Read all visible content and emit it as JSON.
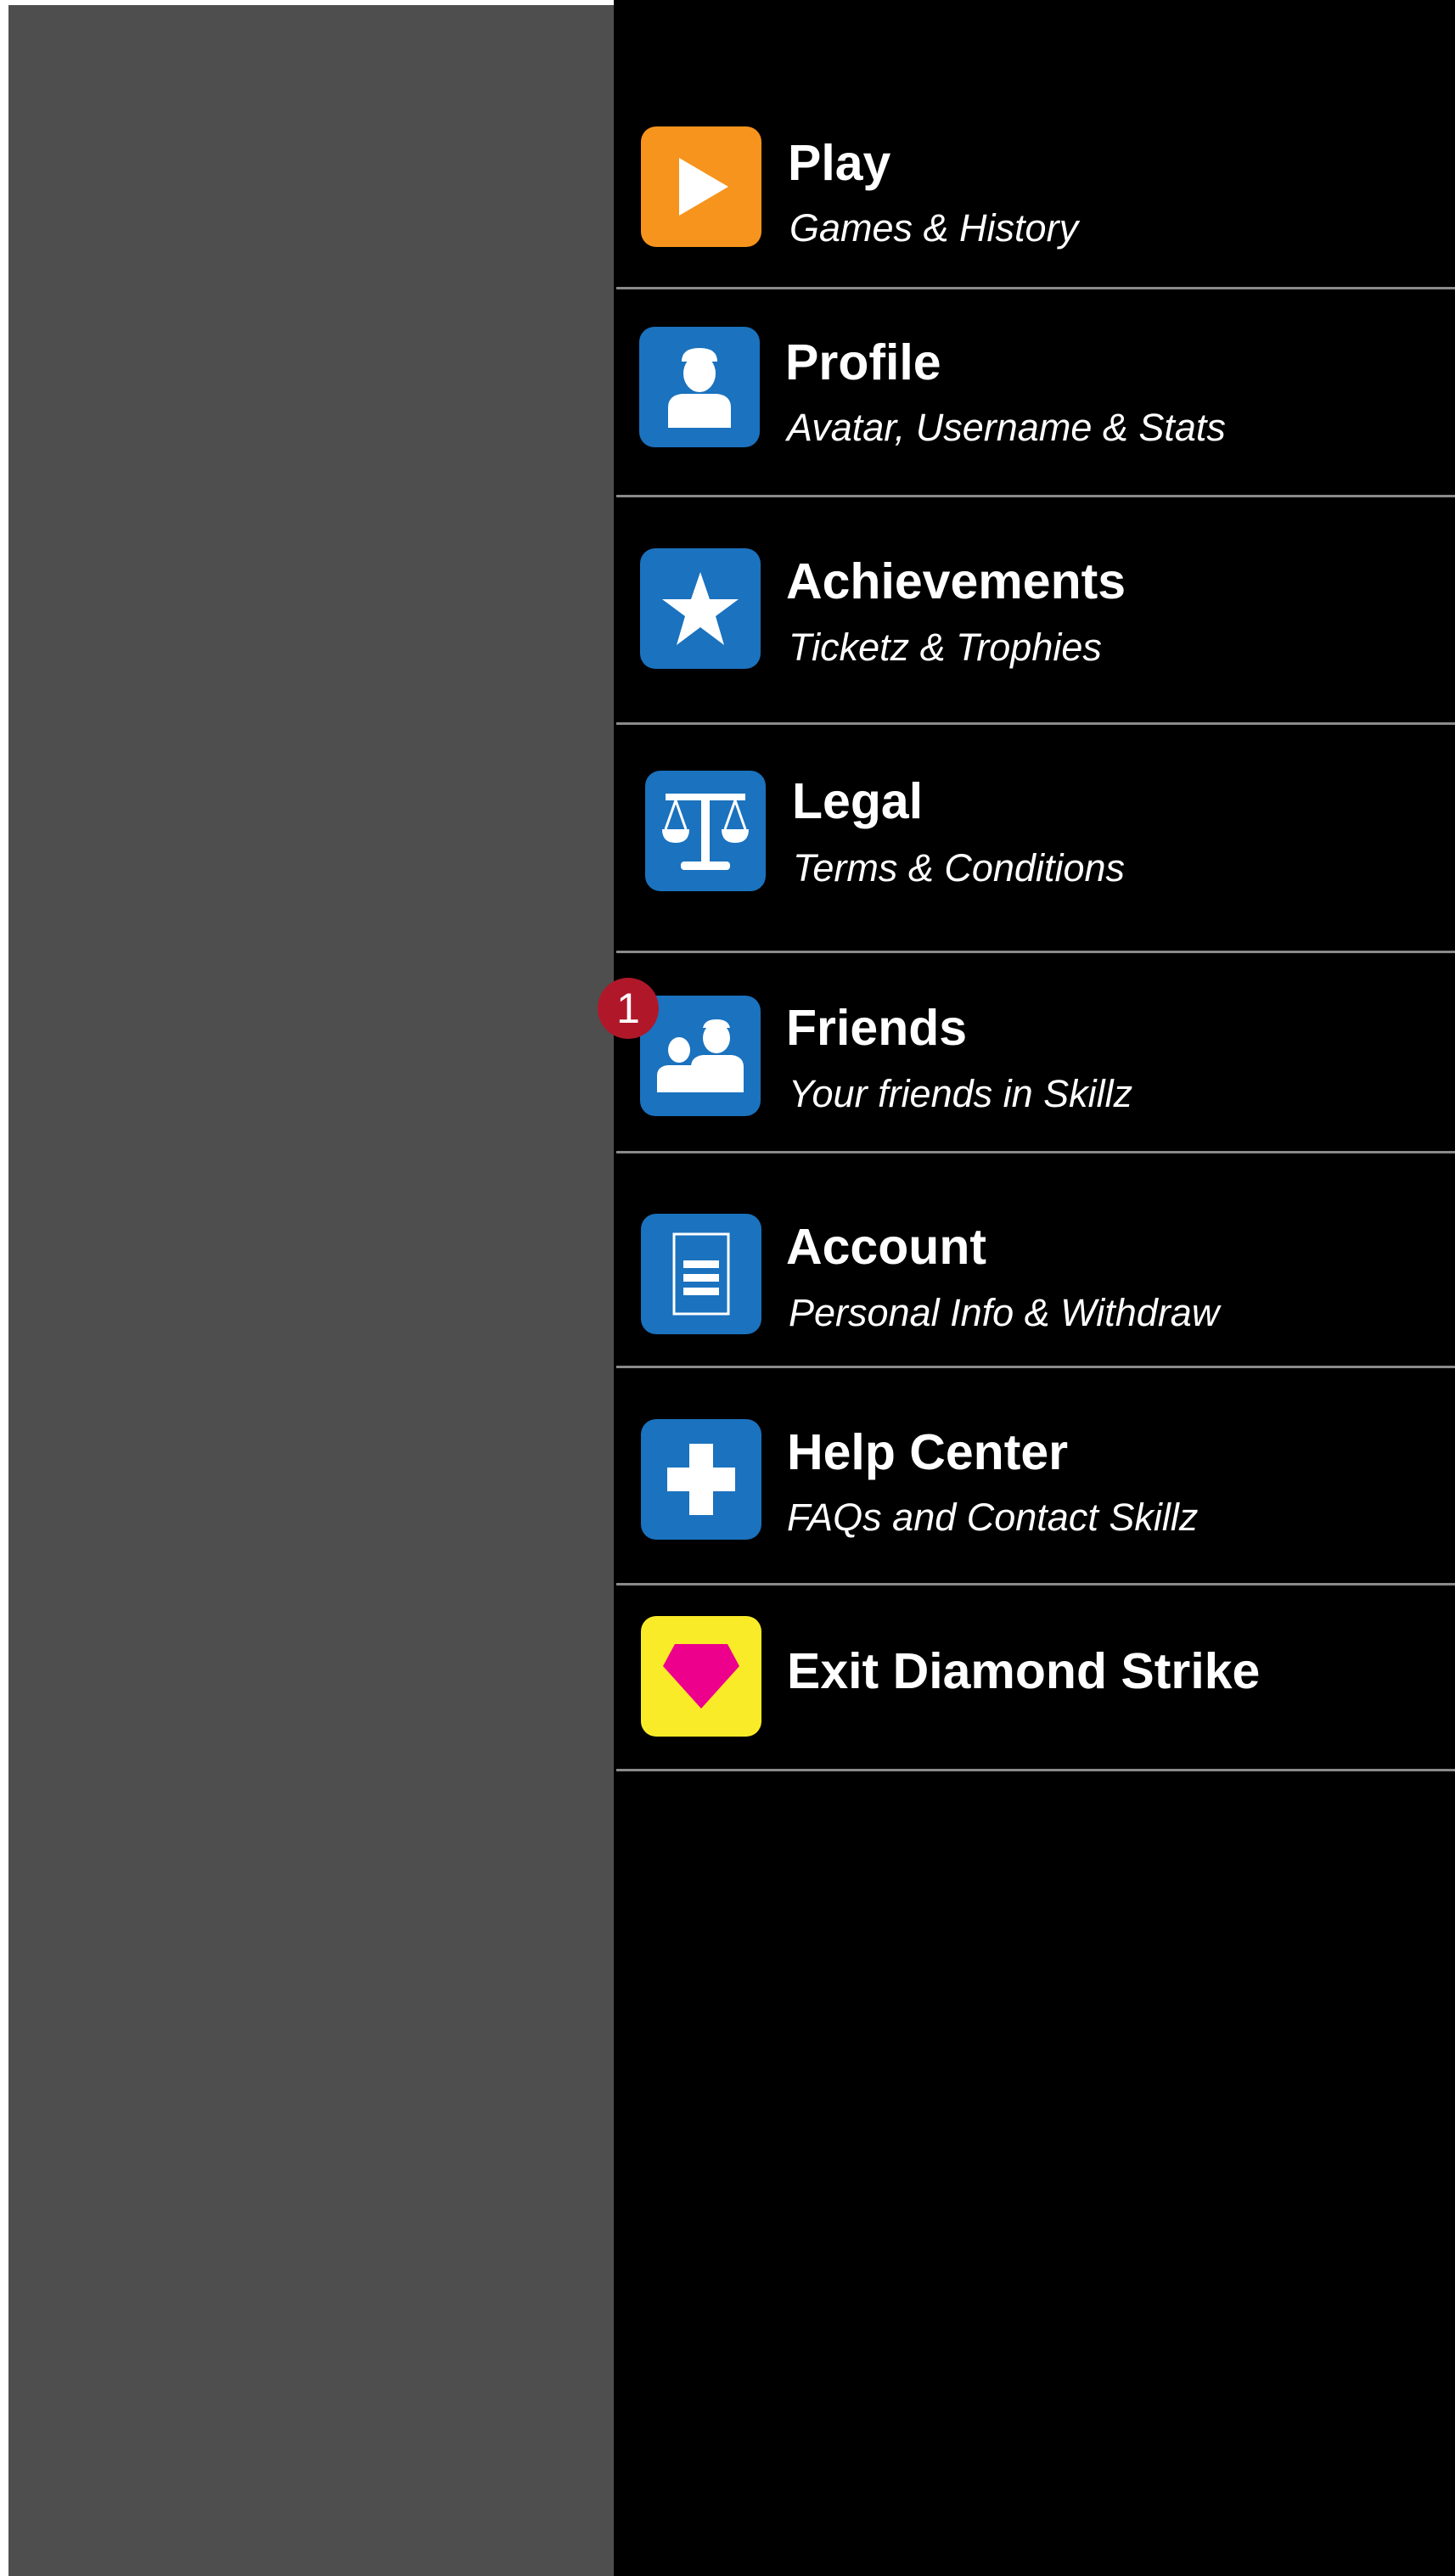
{
  "colors": {
    "overlay": "#4e4e4e",
    "drawer_background": "#000000",
    "divider": "#8a8a8a",
    "play_tile": "#f7941d",
    "blue_tile": "#1b72be",
    "exit_tile": "#f9eb28",
    "diamond": "#ec008c",
    "badge": "#b0182a"
  },
  "menu": {
    "items": [
      {
        "title": "Play",
        "subtitle": "Games & History",
        "icon": "play-icon"
      },
      {
        "title": "Profile",
        "subtitle": "Avatar, Username & Stats",
        "icon": "user-icon"
      },
      {
        "title": "Achievements",
        "subtitle": "Ticketz & Trophies",
        "icon": "star-icon"
      },
      {
        "title": "Legal",
        "subtitle": "Terms & Conditions",
        "icon": "scales-icon"
      },
      {
        "title": "Friends",
        "subtitle": "Your friends in Skillz",
        "icon": "friends-icon",
        "badge": "1"
      },
      {
        "title": "Account",
        "subtitle": "Personal Info & Withdraw",
        "icon": "document-icon"
      },
      {
        "title": "Help Center",
        "subtitle": "FAQs and Contact Skillz",
        "icon": "plus-icon"
      },
      {
        "title": "Exit Diamond Strike",
        "icon": "diamond-icon"
      }
    ]
  }
}
